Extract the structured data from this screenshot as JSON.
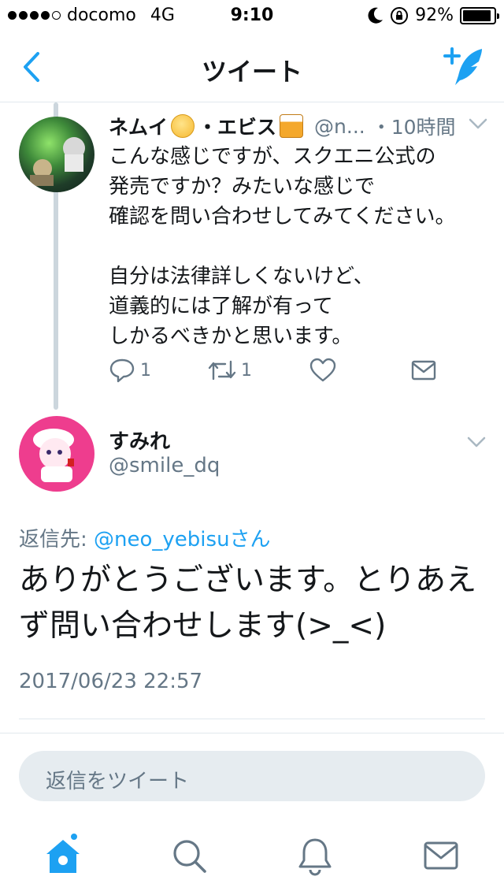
{
  "status_bar": {
    "carrier": "docomo",
    "network": "4G",
    "time": "9:10",
    "battery": "92%",
    "battery_level": 0.92,
    "signal_bars": 4,
    "icons": [
      "moon-icon",
      "rotation-lock-icon",
      "battery-icon"
    ]
  },
  "header": {
    "title": "ツイート",
    "back_icon": "chevron-left-icon",
    "compose_icon": "compose-tweet-icon"
  },
  "parent_tweet": {
    "display_name_part1": "ネムイ",
    "display_name_part2": "・エビス",
    "emoji_1": "sleepy-face-emoji",
    "emoji_2": "beer-mugs-emoji",
    "handle": "@n...",
    "time": "・10時間",
    "body": "こんな感じですが、スクエニ公式の\n発売ですか？みたいな感じで\n確認を問い合わせしてみてください。\n\n自分は法律詳しくないけど、\n道義的には了解が有って\nしかるべきかと思います。",
    "reply_count": "1",
    "retweet_count": "1"
  },
  "main_tweet": {
    "display_name": "すみれ",
    "handle": "@smile_dq",
    "reply_to_label": "返信先: ",
    "reply_to_user": "@neo_yebisuさん",
    "body": "ありがとうございます。とりあえず問い合わせします(>_<)",
    "date": "2017/06/23 22:57"
  },
  "reply_box": {
    "placeholder": "返信をツイート"
  },
  "tab_bar": {
    "tabs": [
      "home-icon",
      "search-icon",
      "notifications-icon",
      "messages-icon"
    ],
    "accent_color": "#1da1f2",
    "inactive_color": "#657786"
  }
}
